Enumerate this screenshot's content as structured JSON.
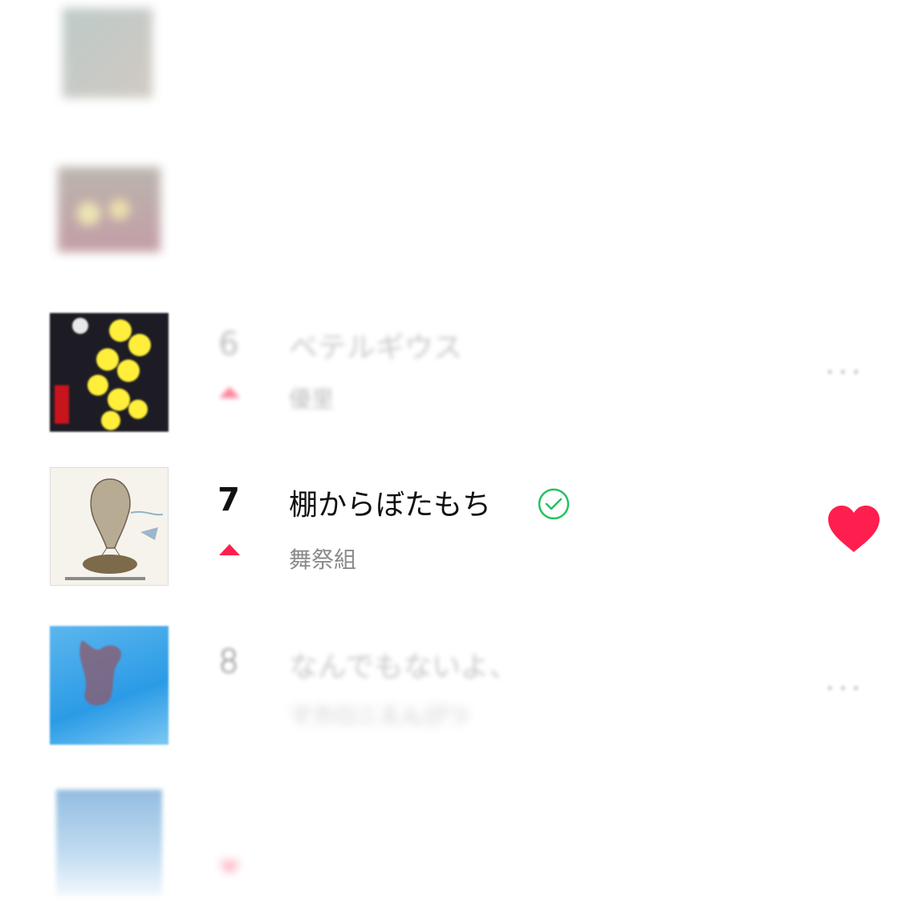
{
  "rows": [
    {
      "rank": "",
      "title": "",
      "artist": "",
      "trend": ""
    },
    {
      "rank": "",
      "title": "",
      "artist": "",
      "trend": ""
    },
    {
      "rank": "6",
      "title": "ベテルギウス",
      "artist": "優里",
      "trend": "up"
    },
    {
      "rank": "7",
      "title": "棚からぼたもち",
      "artist": "舞祭組",
      "trend": "up",
      "downloaded": true,
      "liked": true
    },
    {
      "rank": "8",
      "title": "なんでもないよ、",
      "artist": "マカロニえんぴつ",
      "trend": ""
    },
    {
      "rank": "",
      "title": "",
      "artist": "",
      "trend": "down"
    }
  ],
  "more_label": "...",
  "colors": {
    "accent": "#ff1f4e",
    "check": "#22c35e"
  }
}
